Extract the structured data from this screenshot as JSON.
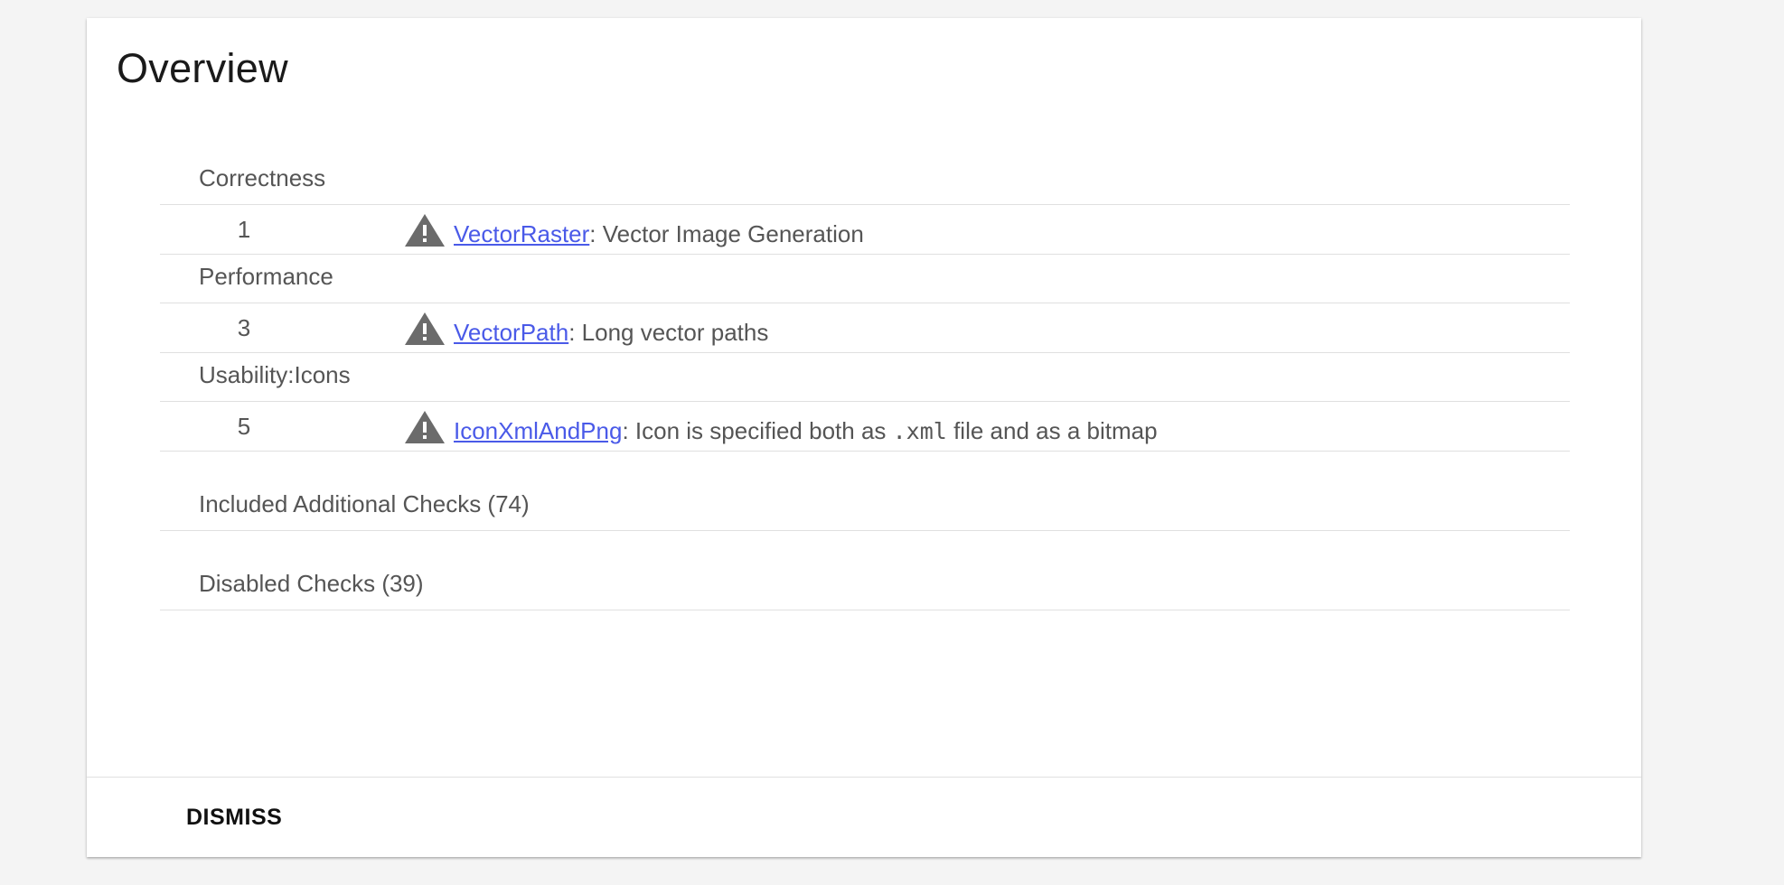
{
  "card": {
    "title": "Overview"
  },
  "categories": [
    {
      "name": "Correctness",
      "issues": [
        {
          "count": "1",
          "icon": "warning-icon",
          "link": "VectorRaster",
          "separator": ": ",
          "description": "Vector Image Generation"
        }
      ]
    },
    {
      "name": "Performance",
      "issues": [
        {
          "count": "3",
          "icon": "warning-icon",
          "link": "VectorPath",
          "separator": ": ",
          "description": "Long vector paths"
        }
      ]
    },
    {
      "name": "Usability:Icons",
      "issues": [
        {
          "count": "5",
          "icon": "warning-icon",
          "link": "IconXmlAndPng",
          "separator": ": ",
          "description_before": "Icon is specified both as ",
          "description_code": ".xml",
          "description_after": " file and as a bitmap"
        }
      ]
    }
  ],
  "extra_sections": {
    "included_checks": "Included Additional Checks (74)",
    "disabled_checks": "Disabled Checks (39)"
  },
  "footer": {
    "dismiss_label": "DISMISS"
  },
  "colors": {
    "link": "#4a5ae8",
    "icon": "#6b6b6b",
    "divider": "#e0e0e0",
    "background": "#f4f4f4"
  }
}
